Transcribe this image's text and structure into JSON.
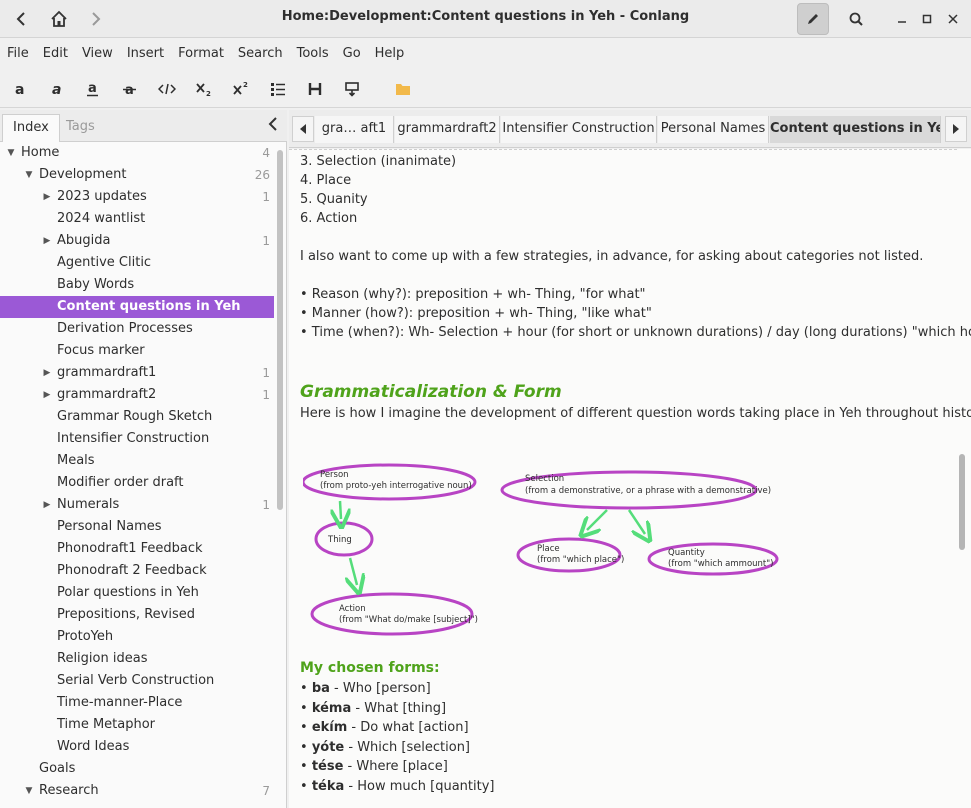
{
  "window": {
    "title": "Home:Development:Content questions in Yeh - Conlang"
  },
  "menubar": {
    "items": [
      "File",
      "Edit",
      "View",
      "Insert",
      "Format",
      "Search",
      "Tools",
      "Go",
      "Help"
    ]
  },
  "toolbar": {
    "icons": [
      "bold",
      "italic",
      "underline",
      "strikethrough",
      "code",
      "subscript",
      "superscript",
      "bullet-list",
      "heading",
      "insert-field",
      "folder"
    ]
  },
  "sidebar": {
    "tabs": [
      "Index",
      "Tags"
    ],
    "tree": [
      {
        "label": "Home",
        "count": "4",
        "level": 0,
        "state": "expanded"
      },
      {
        "label": "Development",
        "count": "26",
        "level": 1,
        "state": "expanded"
      },
      {
        "label": "2023 updates",
        "count": "1",
        "level": 2,
        "state": "collapsed"
      },
      {
        "label": "2024 wantlist",
        "count": "",
        "level": 2,
        "state": "leaf"
      },
      {
        "label": "Abugida",
        "count": "1",
        "level": 2,
        "state": "collapsed"
      },
      {
        "label": "Agentive Clitic",
        "count": "",
        "level": 2,
        "state": "leaf"
      },
      {
        "label": "Baby Words",
        "count": "",
        "level": 2,
        "state": "leaf"
      },
      {
        "label": "Content questions in Yeh",
        "count": "",
        "level": 2,
        "state": "leaf",
        "selected": true
      },
      {
        "label": "Derivation Processes",
        "count": "",
        "level": 2,
        "state": "leaf"
      },
      {
        "label": "Focus marker",
        "count": "",
        "level": 2,
        "state": "leaf"
      },
      {
        "label": "grammardraft1",
        "count": "1",
        "level": 2,
        "state": "collapsed"
      },
      {
        "label": "grammardraft2",
        "count": "1",
        "level": 2,
        "state": "collapsed"
      },
      {
        "label": "Grammar Rough Sketch",
        "count": "",
        "level": 2,
        "state": "leaf"
      },
      {
        "label": "Intensifier Construction",
        "count": "",
        "level": 2,
        "state": "leaf"
      },
      {
        "label": "Meals",
        "count": "",
        "level": 2,
        "state": "leaf"
      },
      {
        "label": "Modifier order draft",
        "count": "",
        "level": 2,
        "state": "leaf"
      },
      {
        "label": "Numerals",
        "count": "1",
        "level": 2,
        "state": "collapsed"
      },
      {
        "label": "Personal Names",
        "count": "",
        "level": 2,
        "state": "leaf"
      },
      {
        "label": "Phonodraft1 Feedback",
        "count": "",
        "level": 2,
        "state": "leaf"
      },
      {
        "label": "Phonodraft 2 Feedback",
        "count": "",
        "level": 2,
        "state": "leaf"
      },
      {
        "label": "Polar questions in Yeh",
        "count": "",
        "level": 2,
        "state": "leaf"
      },
      {
        "label": "Prepositions, Revised",
        "count": "",
        "level": 2,
        "state": "leaf"
      },
      {
        "label": "ProtoYeh",
        "count": "",
        "level": 2,
        "state": "leaf"
      },
      {
        "label": "Religion ideas",
        "count": "",
        "level": 2,
        "state": "leaf"
      },
      {
        "label": "Serial Verb Construction",
        "count": "",
        "level": 2,
        "state": "leaf"
      },
      {
        "label": "Time-manner-Place",
        "count": "",
        "level": 2,
        "state": "leaf"
      },
      {
        "label": "Time Metaphor",
        "count": "",
        "level": 2,
        "state": "leaf"
      },
      {
        "label": "Word Ideas",
        "count": "",
        "level": 2,
        "state": "leaf"
      },
      {
        "label": "Goals",
        "count": "",
        "level": 1,
        "state": "leaf"
      },
      {
        "label": "Research",
        "count": "7",
        "level": 1,
        "state": "expanded"
      }
    ]
  },
  "pagetabs": [
    {
      "label": "gra…   aft1"
    },
    {
      "label": "grammardraft2"
    },
    {
      "label": "Intensifier Construction"
    },
    {
      "label": "Personal Names"
    },
    {
      "label": "Content questions in Yeh",
      "active": true
    }
  ],
  "editor": {
    "list_items": [
      "3. Selection (inanimate)",
      "4. Place",
      "5. Quanity",
      "6. Action"
    ],
    "strategy_intro": "I also want to come up with a few strategies, in advance, for asking about categories not listed.",
    "strategies": [
      "• Reason (why?): preposition + wh- Thing, \"for what\"",
      "• Manner (how?): preposition + wh- Thing, \"like what\"",
      "• Time (when?): Wh- Selection + hour (for short or unknown durations) / day (long durations) \"which hour?\""
    ],
    "heading": "Grammaticalization & Form",
    "heading_intro": "Here is how I imagine the development of different question words taking place in Yeh throughout history:",
    "diagram": {
      "person": [
        "Person",
        "(from proto-yeh interrogative noun)"
      ],
      "thing": [
        "Thing"
      ],
      "action": [
        "Action",
        "(from \"What do/make [subject]\")"
      ],
      "selection": [
        "Selection",
        "(from a demonstrative, or a phrase with a demonstrative)"
      ],
      "place": [
        "Place",
        "(from \"which place\")"
      ],
      "quantity": [
        "Quantity",
        "(from \"which ammount\")"
      ]
    },
    "forms_heading": "My chosen forms:",
    "forms": [
      {
        "word": "ba",
        "gloss": " - Who [person]"
      },
      {
        "word": "kéma",
        "gloss": " - What [thing]"
      },
      {
        "word": "ekím",
        "gloss": " - Do what [action]"
      },
      {
        "word": "yóte",
        "gloss": " - Which [selection]"
      },
      {
        "word": "tése",
        "gloss": " - Where [place]"
      },
      {
        "word": "téka",
        "gloss": " - How much [quantity]"
      }
    ]
  },
  "colors": {
    "accent": "#9b59d6",
    "heading_green": "#4fa31b",
    "diagram_ellipse": "#b844c4",
    "diagram_arrow": "#55dd7a"
  }
}
